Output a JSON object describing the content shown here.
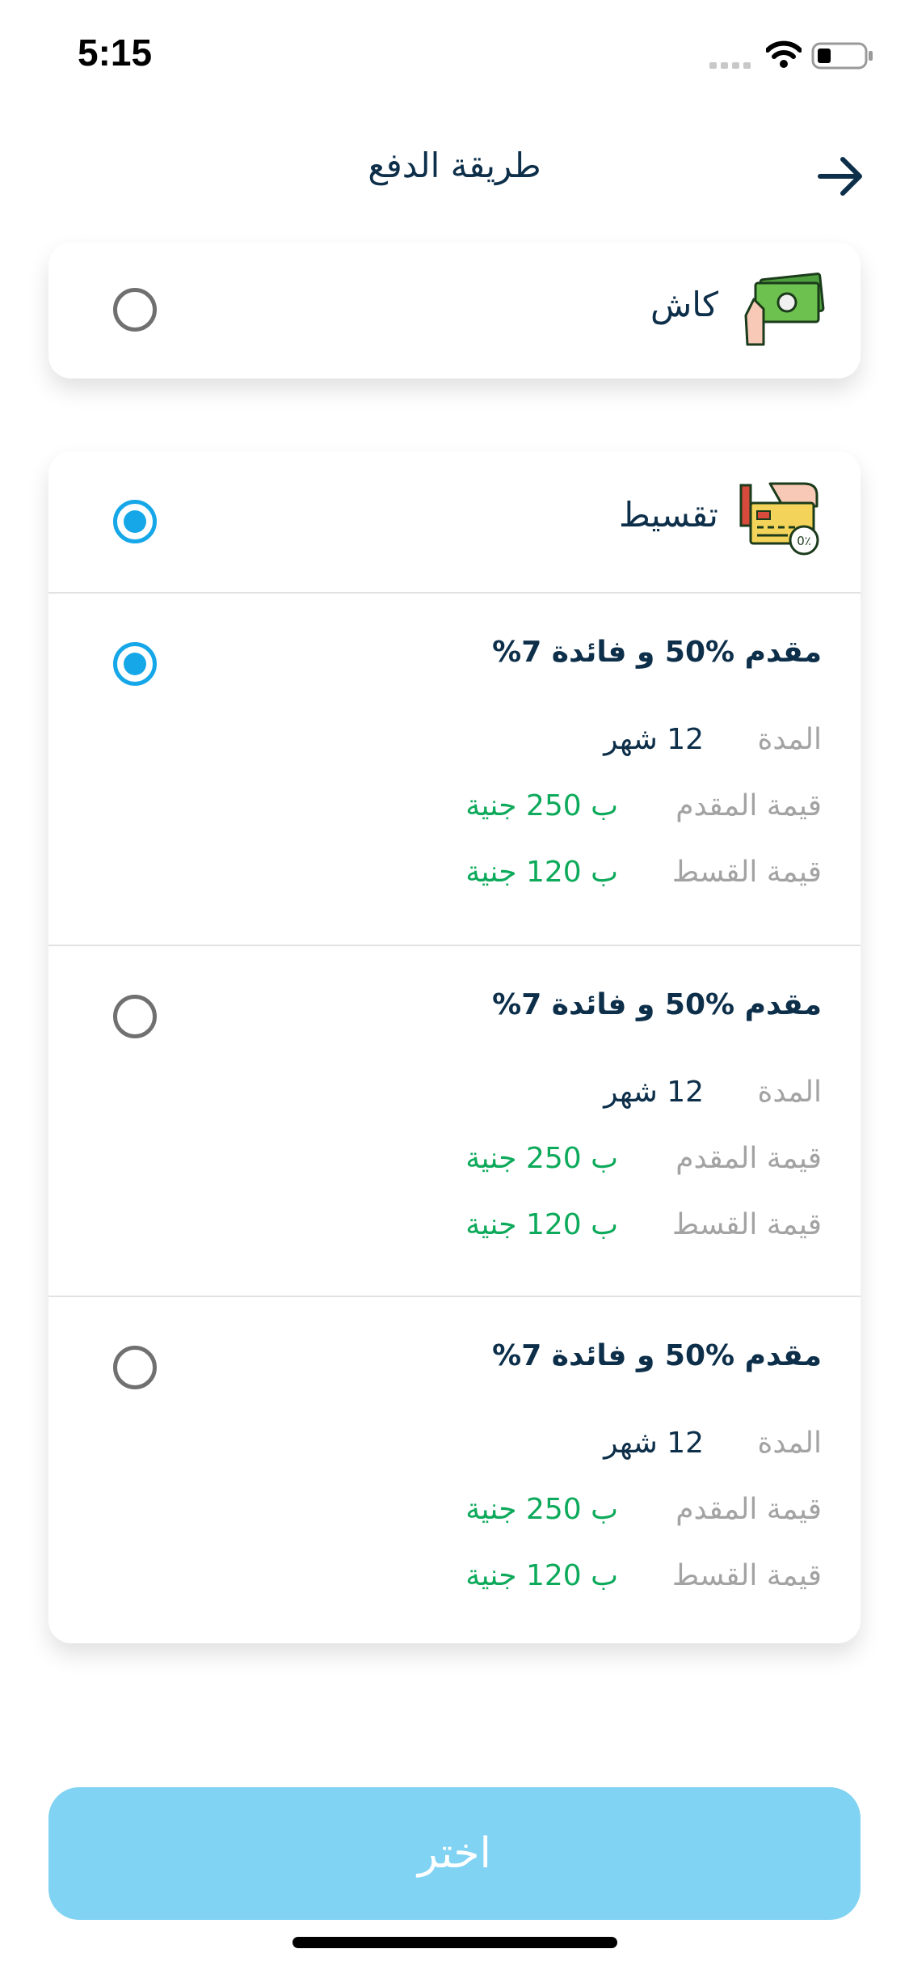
{
  "status": {
    "time": "5:15"
  },
  "header": {
    "title": "طريقة الدفع"
  },
  "payment_methods": {
    "cash": {
      "label": "كاش",
      "selected": false,
      "icon": "cash-hand-icon"
    },
    "installment": {
      "label": "تقسيط",
      "selected": true,
      "icon": "installment-card-icon"
    }
  },
  "plans": [
    {
      "title": "مقدم %50 و فائدة 7%",
      "duration_label": "المدة",
      "duration_value": "12 شهر",
      "down_label": "قيمة المقدم",
      "down_value": "ب 250 جنية",
      "installment_label": "قيمة القسط",
      "installment_value": "ب 120 جنية",
      "selected": true
    },
    {
      "title": "مقدم %50 و فائدة 7%",
      "duration_label": "المدة",
      "duration_value": "12 شهر",
      "down_label": "قيمة المقدم",
      "down_value": "ب 250 جنية",
      "installment_label": "قيمة القسط",
      "installment_value": "ب 120 جنية",
      "selected": false
    },
    {
      "title": "مقدم %50 و فائدة 7%",
      "duration_label": "المدة",
      "duration_value": "12 شهر",
      "down_label": "قيمة المقدم",
      "down_value": "ب 250 جنية",
      "installment_label": "قيمة القسط",
      "installment_value": "ب 120 جنية",
      "selected": false
    }
  ],
  "footer": {
    "choose_label": "اختر"
  },
  "colors": {
    "accent": "#16a7e8",
    "button": "#80d3f3",
    "price": "#0eaa5b",
    "text": "#0d2f4a",
    "muted": "#a3a3a3"
  }
}
